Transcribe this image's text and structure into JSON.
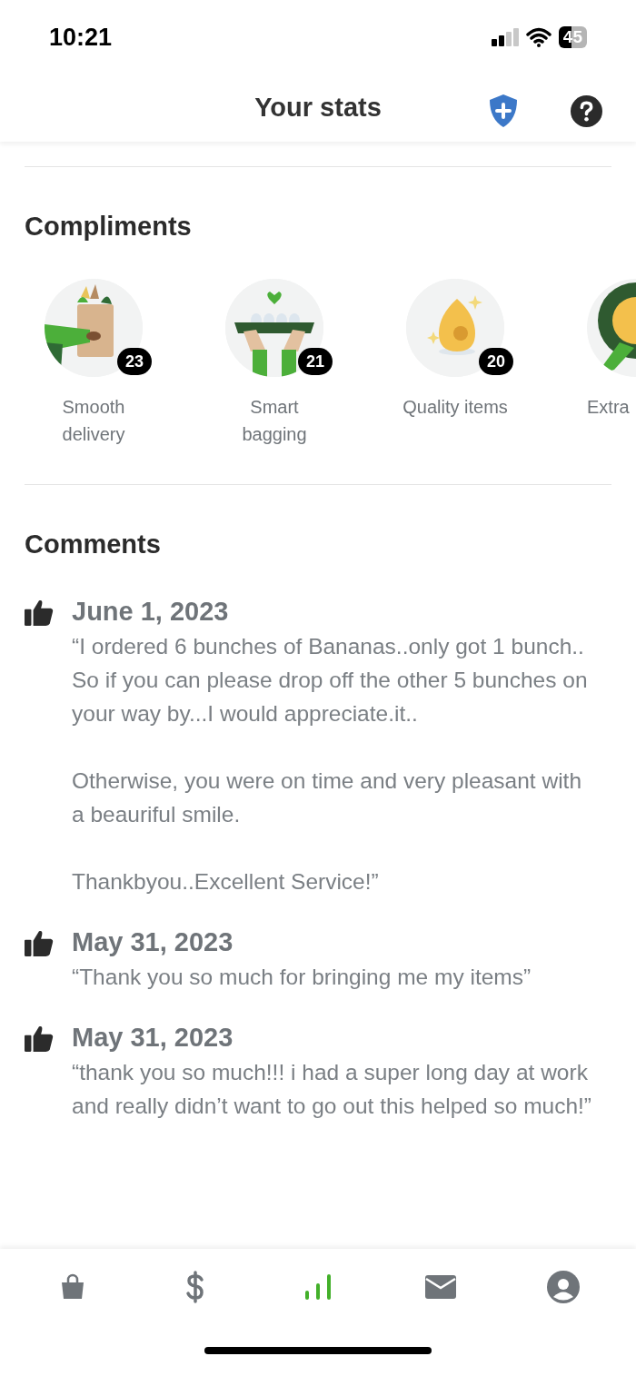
{
  "status_bar": {
    "time": "10:21",
    "battery": "45"
  },
  "header": {
    "title": "Your stats"
  },
  "compliments": {
    "title": "Compliments",
    "items": [
      {
        "kind": "bag",
        "label": "Smooth delivery",
        "count": "23"
      },
      {
        "kind": "eggs",
        "label": "Smart bagging",
        "count": "21"
      },
      {
        "kind": "egg",
        "label": "Quality items",
        "count": "20"
      },
      {
        "kind": "ribbon",
        "label": "Extra"
      }
    ]
  },
  "comments": {
    "title": "Comments",
    "items": [
      {
        "date": "June 1, 2023",
        "paragraphs": [
          "“I ordered 6 bunches of Bananas..only got 1 bunch.. So if you can please drop off the other 5 bunches on your way by...I would appreciate.it..",
          "Otherwise, you were on time and very pleasant with a beauriful smile.",
          "Thankbyou..Excellent Service!”"
        ]
      },
      {
        "date": "May 31, 2023",
        "paragraphs": [
          "“Thank you so much for bringing me my items”"
        ]
      },
      {
        "date": "May 31, 2023",
        "paragraphs": [
          "“thank you so much!!! i had a super long day at work and really didn’t want to go out this helped so much!”"
        ]
      }
    ]
  },
  "tab_bar": [
    {
      "kind": "shop",
      "selected": false
    },
    {
      "kind": "earnings",
      "selected": false
    },
    {
      "kind": "stats",
      "selected": true
    },
    {
      "kind": "messages",
      "selected": false
    },
    {
      "kind": "account",
      "selected": false
    }
  ]
}
